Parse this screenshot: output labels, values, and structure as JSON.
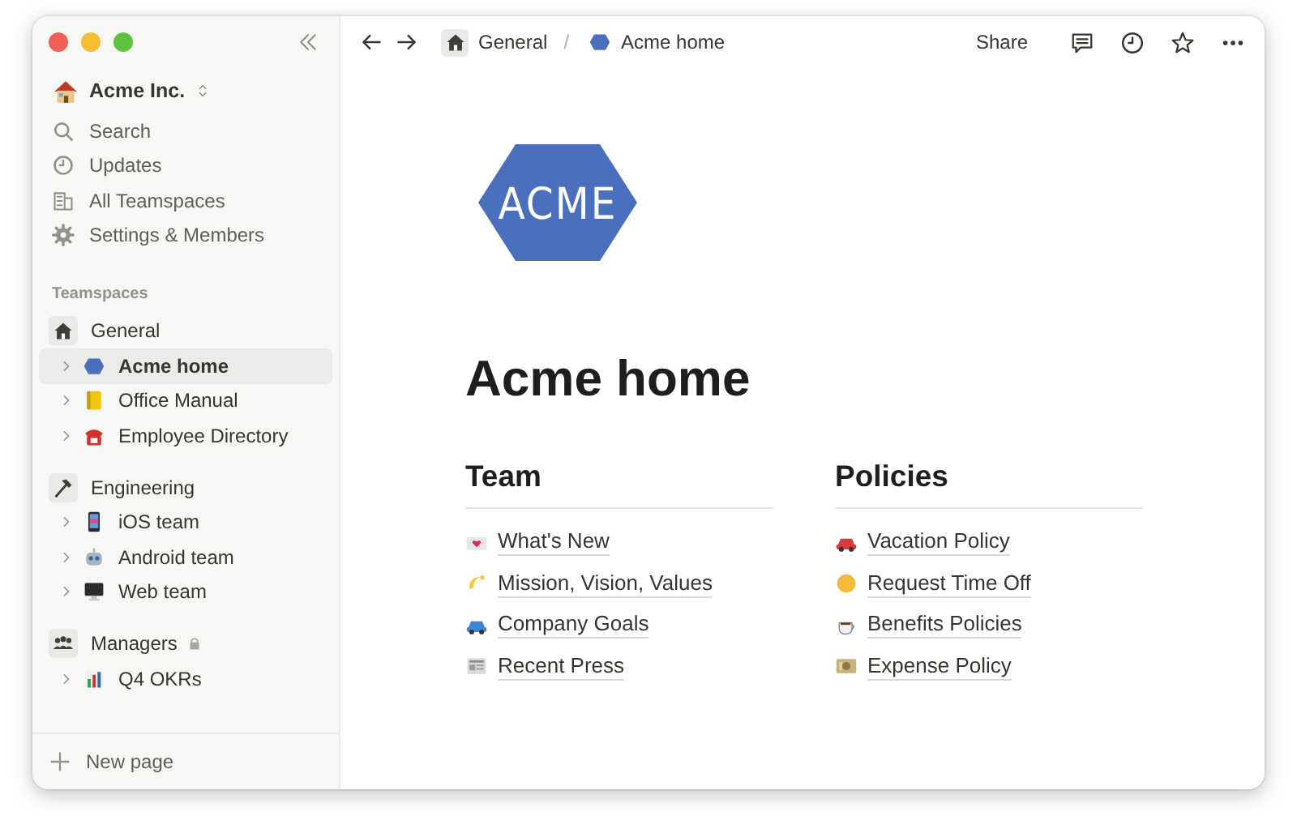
{
  "sidebar": {
    "workspace": "Acme Inc.",
    "nav": [
      {
        "label": "Search"
      },
      {
        "label": "Updates"
      },
      {
        "label": "All Teamspaces"
      },
      {
        "label": "Settings & Members"
      }
    ],
    "section_label": "Teamspaces",
    "teamspaces": [
      {
        "name": "General",
        "locked": false,
        "pages": [
          {
            "title": "Acme home",
            "selected": true
          },
          {
            "title": "Office Manual",
            "selected": false
          },
          {
            "title": "Employee Directory",
            "selected": false
          }
        ]
      },
      {
        "name": "Engineering",
        "locked": false,
        "pages": [
          {
            "title": "iOS team",
            "selected": false
          },
          {
            "title": "Android team",
            "selected": false
          },
          {
            "title": "Web team",
            "selected": false
          }
        ]
      },
      {
        "name": "Managers",
        "locked": true,
        "pages": [
          {
            "title": "Q4 OKRs",
            "selected": false
          }
        ]
      }
    ],
    "new_page": "New page"
  },
  "topbar": {
    "breadcrumbs": [
      "General",
      "Acme home"
    ],
    "separator": "/",
    "share": "Share"
  },
  "page": {
    "logo_text": "ACME",
    "title": "Acme home",
    "columns": [
      {
        "heading": "Team",
        "links": [
          "What's New",
          "Mission, Vision, Values",
          "Company Goals",
          "Recent Press"
        ]
      },
      {
        "heading": "Policies",
        "links": [
          "Vacation Policy",
          "Request Time Off",
          "Benefits Policies",
          "Expense Policy"
        ]
      }
    ]
  }
}
